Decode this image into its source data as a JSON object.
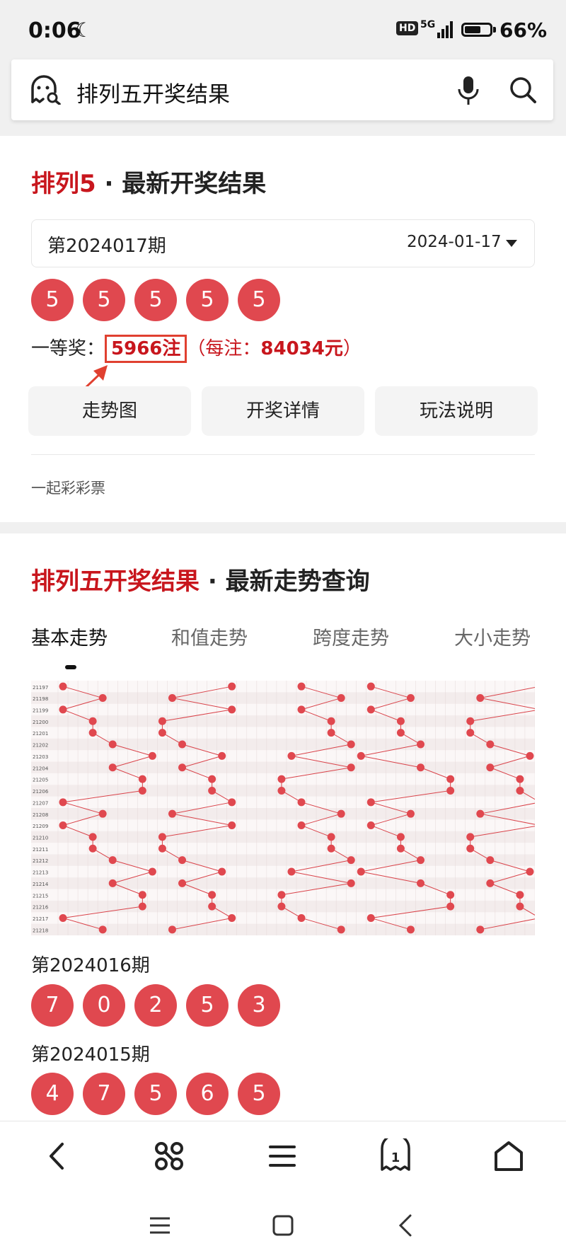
{
  "status_bar": {
    "time": "0:06",
    "hd": "HD",
    "network": "5G",
    "battery_pct": "66%",
    "battery_level": 66
  },
  "search": {
    "query": "排列五开奖结果"
  },
  "result_card": {
    "title_highlight": "排列5",
    "title_rest": " · 最新开奖结果",
    "period": "第2024017期",
    "date": "2024-01-17",
    "numbers": [
      "5",
      "5",
      "5",
      "5",
      "5"
    ],
    "prize_label": "一等奖：",
    "prize_count": "5966注",
    "prize_per_prefix": "（每注：",
    "prize_per_amount": "84034元",
    "prize_per_suffix": "）",
    "buttons": [
      "走势图",
      "开奖详情",
      "玩法说明"
    ],
    "source": "一起彩彩票"
  },
  "trend_card": {
    "title_highlight": "排列五开奖结果",
    "title_rest": " · 最新走势查询",
    "tabs": [
      "基本走势",
      "和值走势",
      "跨度走势",
      "大小走势"
    ],
    "history": [
      {
        "period": "第2024016期",
        "numbers": [
          "7",
          "0",
          "2",
          "5",
          "3"
        ]
      },
      {
        "period": "第2024015期",
        "numbers": [
          "4",
          "7",
          "5",
          "6",
          "5"
        ]
      }
    ]
  },
  "chart_data": {
    "type": "table",
    "issues": [
      "21197",
      "21198",
      "21199",
      "21200",
      "21201",
      "21202",
      "21203",
      "21204",
      "21205",
      "21206",
      "21207",
      "21208",
      "21209",
      "21210",
      "21211",
      "21212",
      "21213",
      "21214",
      "21215",
      "21216",
      "21217",
      "21218"
    ]
  },
  "colors": {
    "accent": "#c8161d",
    "ball": "#e0484f"
  },
  "icons": {
    "search_left": "ghost-search-icon",
    "mic": "microphone-icon",
    "search": "search-icon",
    "nav": [
      "back-icon",
      "command-icon",
      "menu-icon",
      "tabs-icon",
      "home-icon"
    ],
    "system": [
      "recents-icon",
      "home-square-icon",
      "back-triangle-icon"
    ]
  }
}
